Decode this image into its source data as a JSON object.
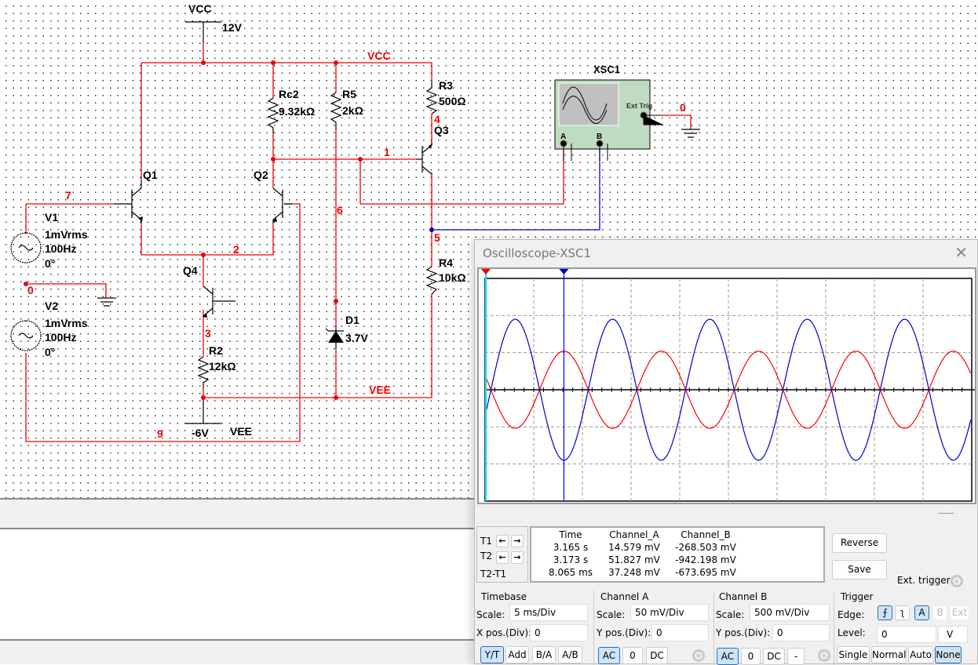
{
  "schematic": {
    "vcc_source": {
      "name": "VCC",
      "value": "12V"
    },
    "vee_source": {
      "name": "VEE",
      "value": "-6V"
    },
    "rail_vcc_label": "VCC",
    "rail_vee_label": "VEE",
    "components": {
      "Q1": "Q1",
      "Q2": "Q2",
      "Q3": "Q3",
      "Q4": "Q4",
      "Rc2": {
        "name": "Rc2",
        "value": "9.32kΩ"
      },
      "R5": {
        "name": "R5",
        "value": "2kΩ"
      },
      "R3": {
        "name": "R3",
        "value": "500Ω"
      },
      "R4": {
        "name": "R4",
        "value": "10kΩ"
      },
      "R2": {
        "name": "R2",
        "value": "12kΩ"
      },
      "D1": {
        "name": "D1",
        "value": "3.7V"
      },
      "V1": {
        "name": "V1",
        "amp": "1mVrms",
        "freq": "100Hz",
        "phase": "0°"
      },
      "V2": {
        "name": "V2",
        "amp": "1mVrms",
        "freq": "100Hz",
        "phase": "0°"
      }
    },
    "nodes": {
      "n0": "0",
      "n1": "1",
      "n2": "2",
      "n3": "3",
      "n4": "4",
      "n5": "5",
      "n6": "6",
      "n7": "7",
      "n9": "9",
      "scope_gnd": "0"
    },
    "scope_symbol": {
      "name": "XSC1",
      "ext_trig": "Ext Trig",
      "a": "A",
      "b": "B",
      "plus": "+",
      "minus": "_"
    }
  },
  "oscilloscope": {
    "title": "Oscilloscope-XSC1",
    "close_icon": "close-icon",
    "cursors": {
      "t1": "1",
      "t2": "2"
    },
    "readout": {
      "headers": [
        "Time",
        "Channel_A",
        "Channel_B"
      ],
      "row_labels": [
        "T1",
        "T2",
        "T2-T1"
      ],
      "rows": [
        [
          "3.165 s",
          "14.579 mV",
          "-268.503 mV"
        ],
        [
          "3.173 s",
          "51.827 mV",
          "-942.198 mV"
        ],
        [
          "8.065 ms",
          "37.248 mV",
          "-673.695 mV"
        ]
      ]
    },
    "reverse": "Reverse",
    "save": "Save",
    "ext_trigger": "Ext. trigger",
    "timebase": {
      "title": "Timebase",
      "scale_label": "Scale:",
      "scale": "5 ms/Div",
      "xpos_label": "X pos.(Div):",
      "xpos": "0",
      "modes": [
        "Y/T",
        "Add",
        "B/A",
        "A/B"
      ],
      "active_mode": "Y/T"
    },
    "channel_a": {
      "title": "Channel A",
      "scale_label": "Scale:",
      "scale": "50 mV/Div",
      "ypos_label": "Y pos.(Div):",
      "ypos": "0",
      "coupling": [
        "AC",
        "0",
        "DC"
      ],
      "active": "AC"
    },
    "channel_b": {
      "title": "Channel B",
      "scale_label": "Scale:",
      "scale": "500 mV/Div",
      "ypos_label": "Y pos.(Div):",
      "ypos": "0",
      "coupling": [
        "AC",
        "0",
        "DC",
        "-"
      ],
      "active": "AC"
    },
    "trigger": {
      "title": "Trigger",
      "edge_label": "Edge:",
      "edge_rise": "rising-edge-icon",
      "edge_fall": "falling-edge-icon",
      "sources": [
        "A",
        "B",
        "Ext"
      ],
      "active_source": "A",
      "level_label": "Level:",
      "level": "0",
      "level_unit": "V",
      "modes": [
        "Single",
        "Normal",
        "Auto",
        "None"
      ],
      "active_mode": "None"
    },
    "colors": {
      "channel_a": "#ff0000",
      "channel_b": "#0000cc",
      "cursor1": "#00e5ff",
      "cursor2": "#0000ff"
    }
  },
  "chart_data": {
    "type": "line",
    "x_unit": "ms",
    "xlim": [
      0,
      50
    ],
    "x_divisions": 10,
    "y_divisions": 6,
    "grid": true,
    "series": [
      {
        "name": "Channel_A",
        "color": "#ff0000",
        "scale_per_div_mV": 50,
        "amplitude_mV": 52,
        "frequency_Hz": 100,
        "peak_at_ms": 8.1
      },
      {
        "name": "Channel_B",
        "color": "#0000cc",
        "scale_per_div_mV": 500,
        "amplitude_mV": -950,
        "frequency_Hz": 100,
        "peak_at_ms": 8.1
      }
    ],
    "cursors_ms": [
      0,
      8.1
    ]
  }
}
